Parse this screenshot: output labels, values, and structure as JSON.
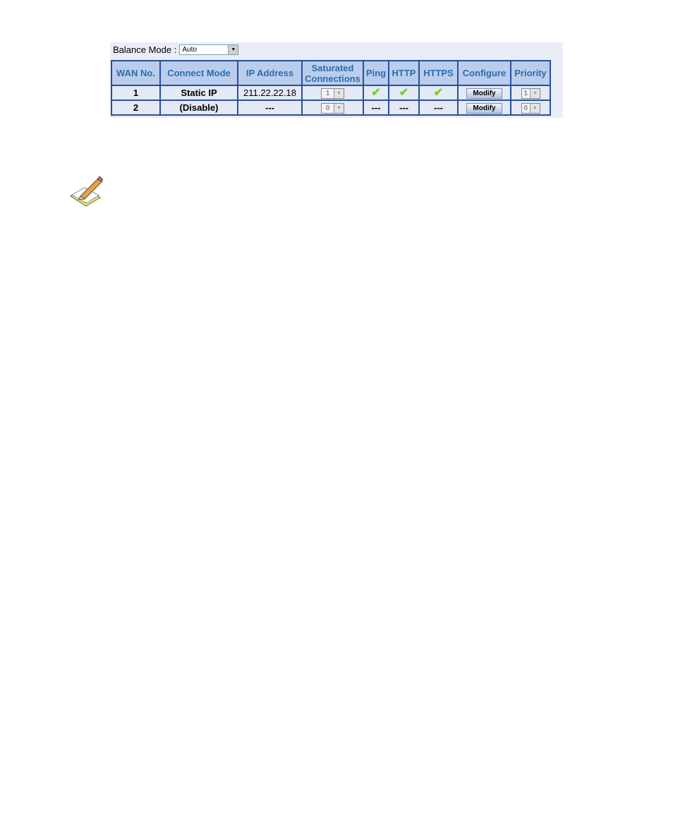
{
  "balance_mode": {
    "label": "Balance Mode :",
    "value": "Auto"
  },
  "table": {
    "headers": [
      "WAN No.",
      "Connect Mode",
      "IP Address",
      "Saturated Connections",
      "Ping",
      "HTTP",
      "HTTPS",
      "Configure",
      "Priority"
    ],
    "rows": [
      {
        "wan": "1",
        "mode": "Static IP",
        "ip": "211.22.22.18",
        "saturated": "1",
        "ping": "check",
        "http": "check",
        "https": "check",
        "configure": "Modify",
        "priority": "1"
      },
      {
        "wan": "2",
        "mode": "(Disable)",
        "ip": "---",
        "saturated": "0",
        "ping": "---",
        "http": "---",
        "https": "---",
        "configure": "Modify",
        "priority": "0"
      }
    ]
  },
  "colors": {
    "header_bg": "#bacdec",
    "header_text": "#2c6cae",
    "border": "#2b4f9a",
    "check": "#7ccc20"
  },
  "icons": {
    "note": "note-pencil-icon",
    "status_ok": "check-icon"
  }
}
